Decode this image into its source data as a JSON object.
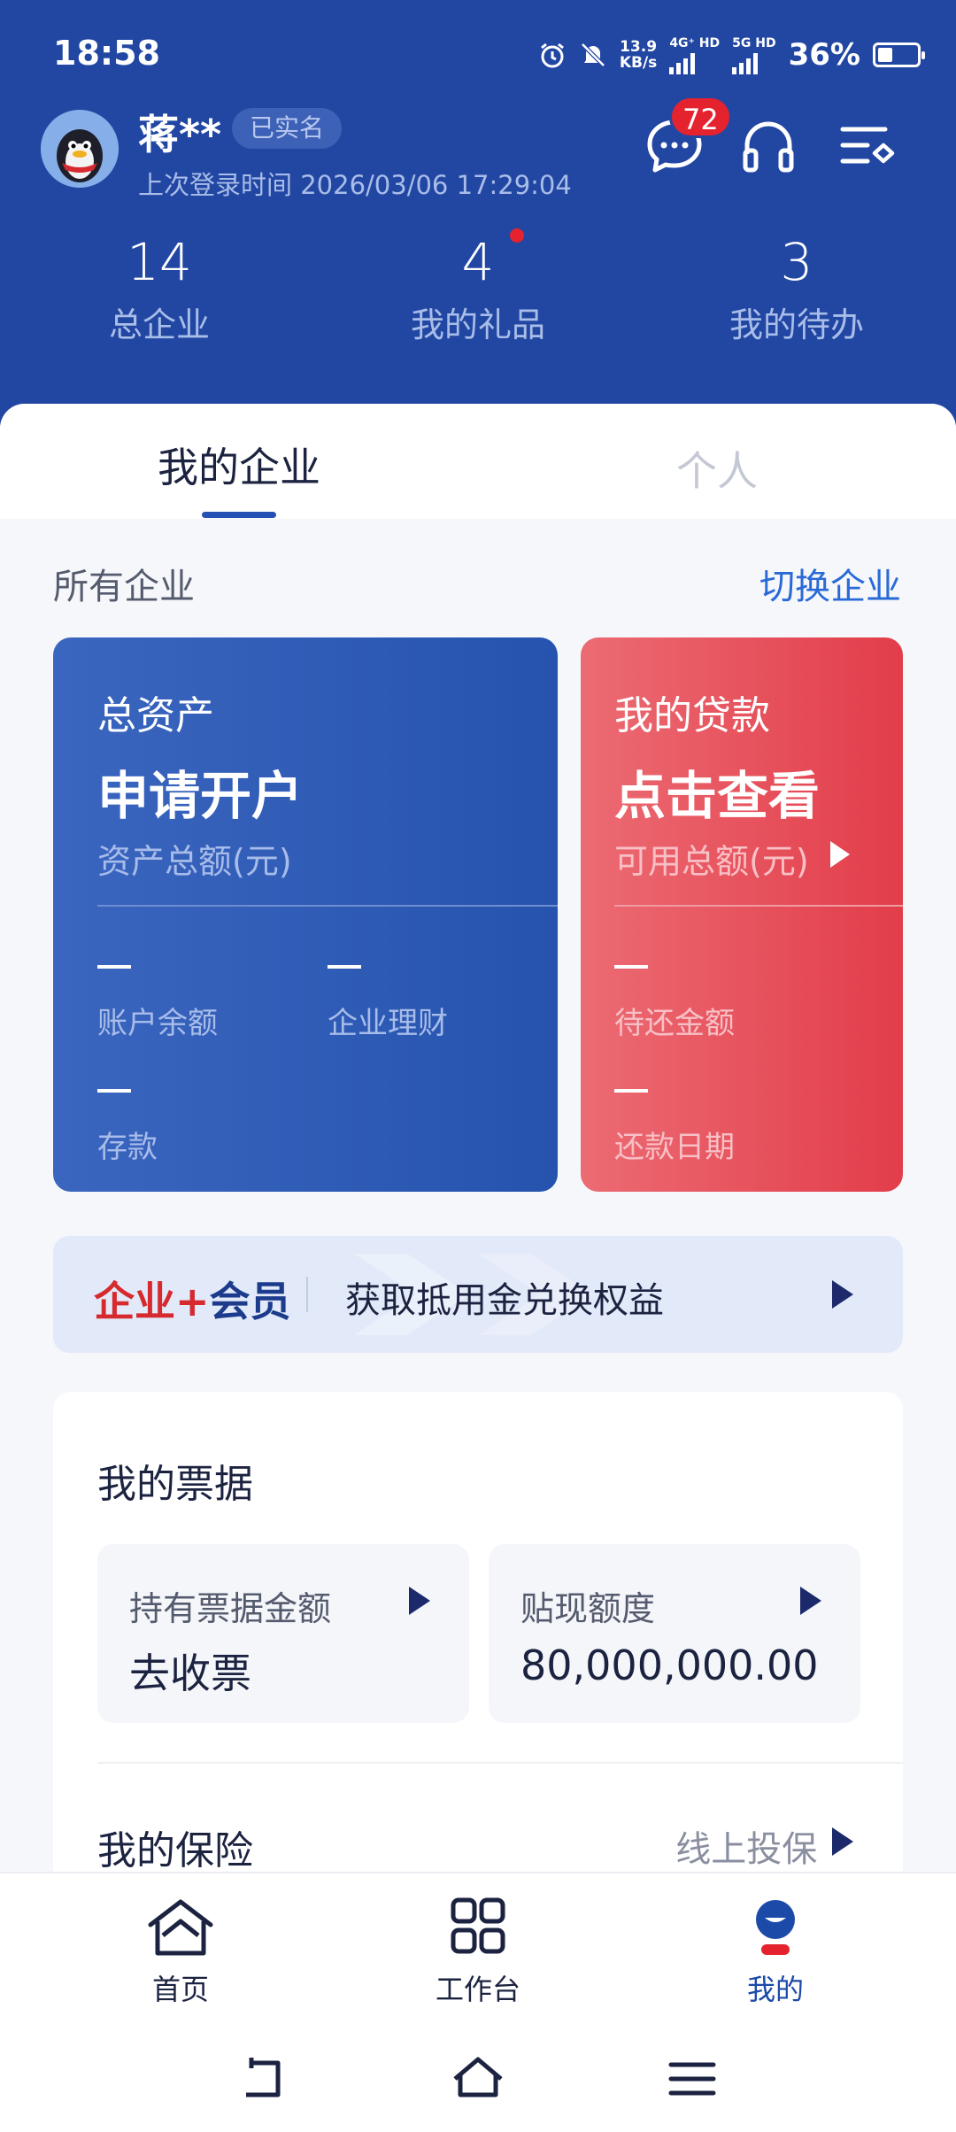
{
  "status_bar": {
    "time": "18:58",
    "net_speed": "13.9",
    "net_unit": "KB/s",
    "network1": "4G⁺ HD",
    "network2": "5G HD",
    "battery": "36%"
  },
  "user": {
    "name": "蒋**",
    "verified_label": "已实名",
    "last_login": "上次登录时间 2026/03/06 17:29:04"
  },
  "header_icons": {
    "message_badge": "72"
  },
  "stats": [
    {
      "value": "14",
      "label": "总企业"
    },
    {
      "value": "4",
      "label": "我的礼品"
    },
    {
      "value": "3",
      "label": "我的待办"
    }
  ],
  "tabs": [
    {
      "label": "我的企业",
      "active": true
    },
    {
      "label": "个人",
      "active": false
    }
  ],
  "section": {
    "label": "所有企业",
    "switch_label": "切换企业"
  },
  "asset_card": {
    "title": "总资产",
    "headline": "申请开户",
    "subtitle": "资产总额(元)",
    "items": [
      {
        "value": "—",
        "label": "账户余额"
      },
      {
        "value": "—",
        "label": "企业理财"
      },
      {
        "value": "—",
        "label": "存款"
      }
    ]
  },
  "loan_card": {
    "title": "我的贷款",
    "headline": "点击查看",
    "subtitle": "可用总额(元)",
    "items": [
      {
        "value": "—",
        "label": "待还金额"
      },
      {
        "value": "—",
        "label": "还款日期"
      }
    ]
  },
  "member_banner": {
    "brand_left": "企业",
    "brand_plus": "+",
    "brand_right": "会员",
    "text": "获取抵用金兑换权益"
  },
  "tickets": {
    "title": "我的票据",
    "holding_label": "持有票据金额",
    "holding_value": "去收票",
    "discount_label": "贴现额度",
    "discount_value": "80,000,000.00"
  },
  "insurance": {
    "title": "我的保险",
    "link": "线上投保"
  },
  "bottom_nav": [
    {
      "label": "首页",
      "icon": "home-icon"
    },
    {
      "label": "工作台",
      "icon": "grid-icon"
    },
    {
      "label": "我的",
      "icon": "profile-icon",
      "active": true
    }
  ],
  "colors": {
    "header_blue": "#2247a3",
    "accent_blue": "#2a6ad6",
    "loan_red": "#e23d4a",
    "badge_red": "#e5232e"
  }
}
